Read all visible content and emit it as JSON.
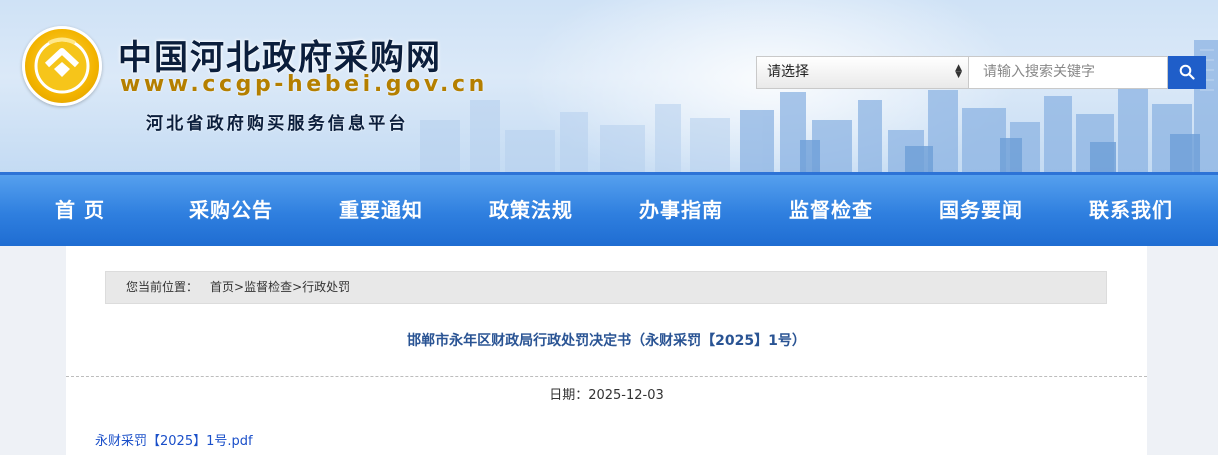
{
  "header": {
    "title": "中国河北政府采购网",
    "url": "www.ccgp-hebei.gov.cn",
    "subtitle": "河北省政府购买服务信息平台",
    "logo_icon": "coin-roof-emblem-icon"
  },
  "search": {
    "select_value": "请选择",
    "placeholder": "请输入搜索关键字",
    "button_icon": "search-icon"
  },
  "nav": {
    "items": [
      {
        "label": "首 页"
      },
      {
        "label": "采购公告"
      },
      {
        "label": "重要通知"
      },
      {
        "label": "政策法规"
      },
      {
        "label": "办事指南"
      },
      {
        "label": "监督检查"
      },
      {
        "label": "国务要闻"
      },
      {
        "label": "联系我们"
      }
    ]
  },
  "breadcrumb": {
    "prefix": "您当前位置：",
    "items": [
      "首页",
      "监督检查",
      "行政处罚"
    ],
    "separator": ">"
  },
  "article": {
    "title": "邯郸市永年区财政局行政处罚决定书（永财采罚【2025】1号）",
    "date_label": "日期：",
    "date": "2025-12-03",
    "attachment": "永财采罚【2025】1号.pdf"
  },
  "colors": {
    "nav_blue": "#2f7fdf",
    "title_blue": "#2a5494",
    "link_blue": "#1a4fc9",
    "search_button": "#1f5ec9",
    "logo_gold": "#f3b400"
  }
}
